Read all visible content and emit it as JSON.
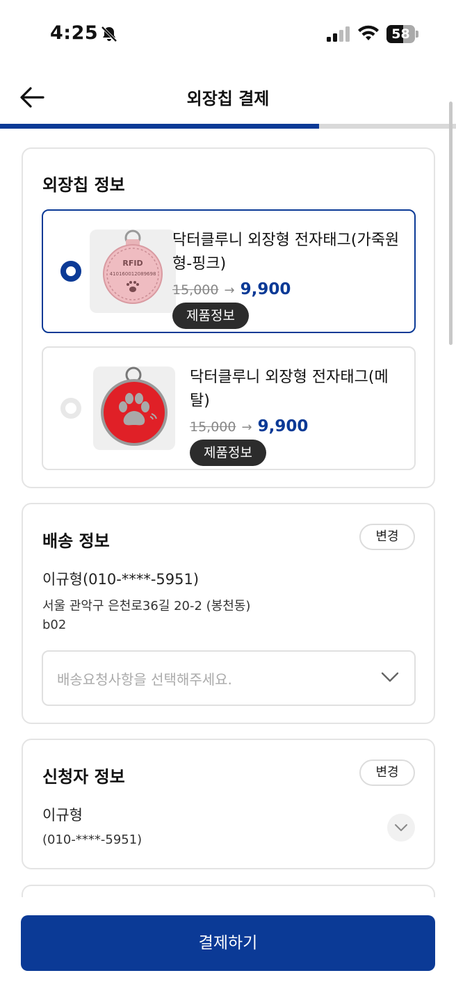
{
  "status_bar": {
    "time": "4:25",
    "battery": "58",
    "battery_level": 0.58
  },
  "header": {
    "title": "외장칩 결제",
    "progress": 0.7
  },
  "chip_info": {
    "title": "외장칩 정보",
    "products": [
      {
        "name": "닥터클루니 외장형 전자태그(가죽원형-핑크)",
        "old_price": "15,000",
        "arrow": "→",
        "new_price": "9,900",
        "info_label": "제품정보",
        "selected": true,
        "tag_text": "RFID",
        "tag_number": "410160012089698"
      },
      {
        "name": "닥터클루니 외장형 전자태그(메탈)",
        "old_price": "15,000",
        "arrow": "→",
        "new_price": "9,900",
        "info_label": "제품정보",
        "selected": false
      }
    ]
  },
  "shipping": {
    "title": "배송 정보",
    "change_label": "변경",
    "recipient": "이규형(010-****-5951)",
    "address_line1": "서울 관악구 은천로36길 20-2 (봉천동)",
    "address_line2": "b02",
    "request_placeholder": "배송요청사항을 선택해주세요."
  },
  "applicant": {
    "title": "신청자 정보",
    "change_label": "변경",
    "name": "이규형",
    "phone": "(010-****-5951)"
  },
  "pay_button": "결제하기"
}
